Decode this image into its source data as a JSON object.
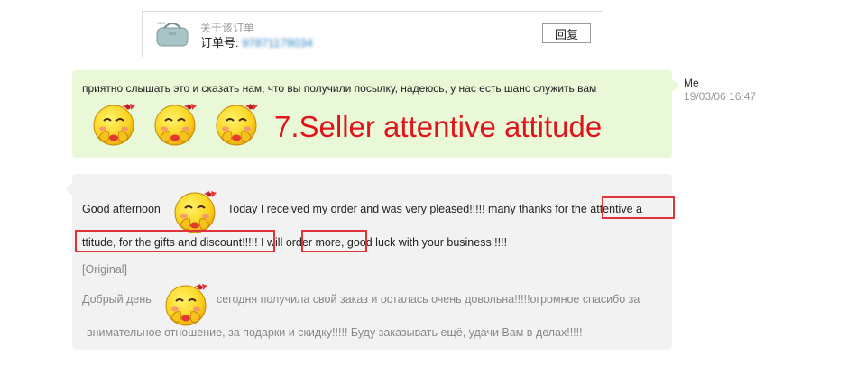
{
  "order_card": {
    "about_label": "关于该订单",
    "order_number_label": "订单号:",
    "order_number_value": "97871178034",
    "reply_button": "回复",
    "thumbnail_icon": "handbag-product-thumbnail"
  },
  "seller_message": {
    "text": "приятно слышать это и сказать нам, что вы получили посылку, надеюсь, у нас есть шанс служить вам",
    "emoji_icons": [
      "blushing-smiley-icon",
      "blushing-smiley-icon",
      "blushing-smiley-icon"
    ],
    "sender": "Me",
    "timestamp": "19/03/06 16:47"
  },
  "overlay_caption": "7.Seller attentive attitude",
  "buyer_message": {
    "greeting": "Good afternoon",
    "line1_rest": "Today I received my order and was very pleased!!!!! many thanks for the ",
    "highlight_a": "attentive a",
    "highlight_b": "ttitude, for the gifts and discount!!!!!",
    "line2_mid": " I will ",
    "highlight_c": "order more,",
    "line2_end": " good luck with your business!!!!!",
    "original_label": "[Original]",
    "ru_greeting": "Добрый день",
    "ru_line1": "сегодня получила свой заказ и осталась очень довольна!!!!!огромное спасибо за",
    "ru_line2": "внимательное отношение, за подарки и скидку!!!!! Буду заказывать ещё, удачи Вам в делах!!!!!"
  },
  "colors": {
    "seller_bubble": "#e9f8d7",
    "buyer_bubble": "#f2f2f2",
    "highlight_box": "#e0343a",
    "caption_red": "#e0151b",
    "order_link": "#2a7fbf"
  }
}
